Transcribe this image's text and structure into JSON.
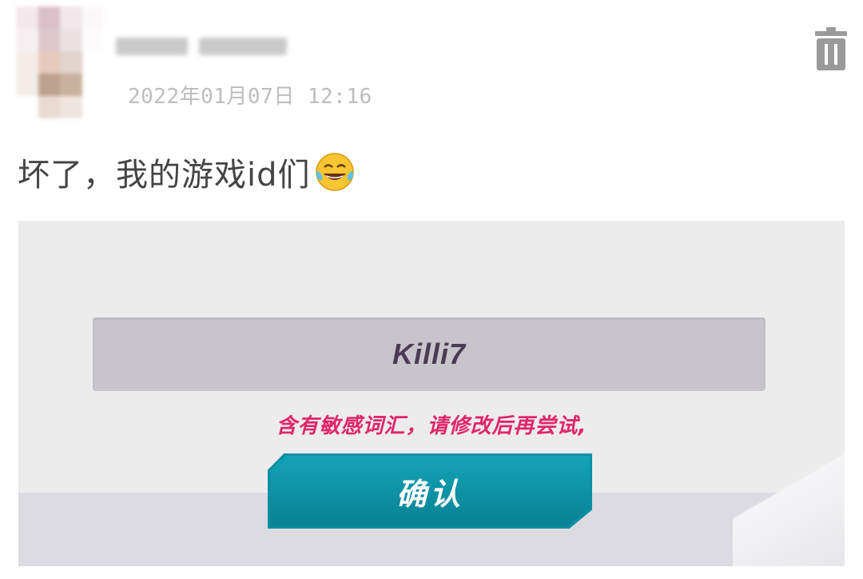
{
  "post": {
    "timestamp": "2022年01月07日 12:16",
    "text": "坏了，我的游戏id们",
    "emoji_icon": "face-with-tears-of-joy-icon"
  },
  "game_dialog": {
    "name_value": "Killi7",
    "warning_text": "含有敏感词汇，请修改后再尝试,",
    "confirm_label": "确认"
  },
  "colors": {
    "warning": "#e0256a",
    "button": "#0d8fa3",
    "field": "#c7c5cb"
  }
}
